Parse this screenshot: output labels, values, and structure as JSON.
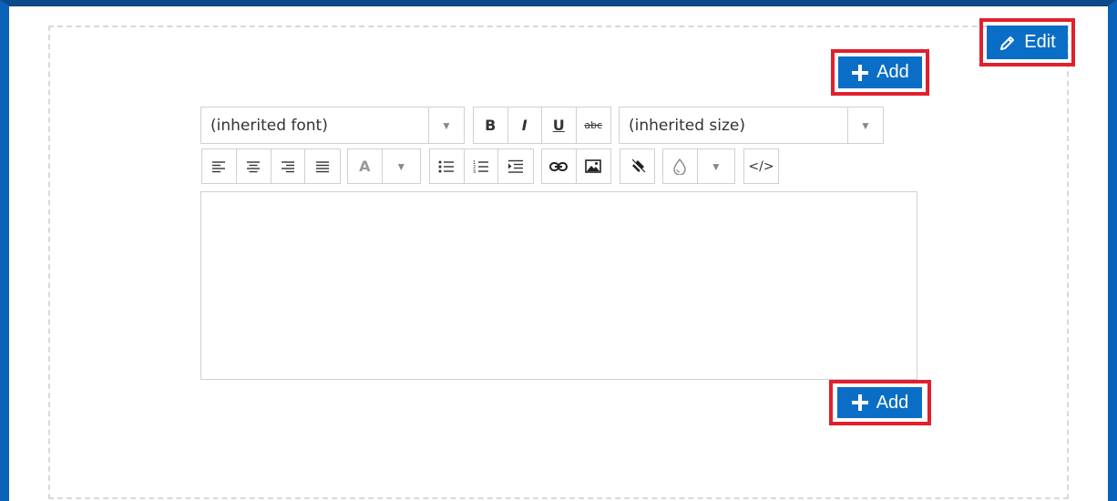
{
  "buttons": {
    "edit_label": "Edit",
    "add_top_label": "Add",
    "add_bottom_label": "Add"
  },
  "toolbar": {
    "font_dropdown": "(inherited font)",
    "size_dropdown": "(inherited size)",
    "bold": "B",
    "italic": "I",
    "underline": "U",
    "strike": "abc",
    "text_color_glyph": "A",
    "code_glyph": "</>"
  },
  "editor": {
    "content": ""
  },
  "colors": {
    "accent": "#0a6ec6",
    "highlight": "#e0202e",
    "frame": "#0a63b8"
  }
}
